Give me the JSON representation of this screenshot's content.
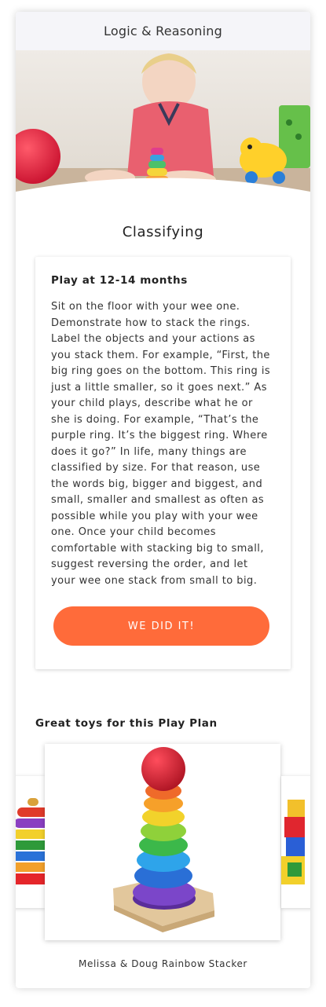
{
  "header": {
    "title": "Logic & Reasoning"
  },
  "plan": {
    "title": "Classifying",
    "age_label": "Play at 12-14 months",
    "description": "Sit on the floor with your wee one. Demonstrate how to stack the rings. Label the objects and your actions as you stack them. For example, “First, the big ring goes on the bottom. This ring is just a little smaller, so it goes next.” As your child plays, describe what he or she is doing. For example, “That’s the purple ring. It’s the biggest ring. Where does it go?” In life, many things are classified by size. For that reason, use the words big, bigger and biggest, and small, smaller and smallest as often as possible while you play with your wee one. Once your child becomes comfortable with stacking big to small, suggest reversing the order, and let your wee one stack from small to big.",
    "cta_label": "WE DID IT!"
  },
  "toys": {
    "heading": "Great toys for this Play Plan",
    "items": [
      {
        "name": "Melissa & Doug Rainbow Stacker"
      }
    ]
  },
  "colors": {
    "accent": "#ff6b3a",
    "header_bg": "#f5f5f9"
  }
}
